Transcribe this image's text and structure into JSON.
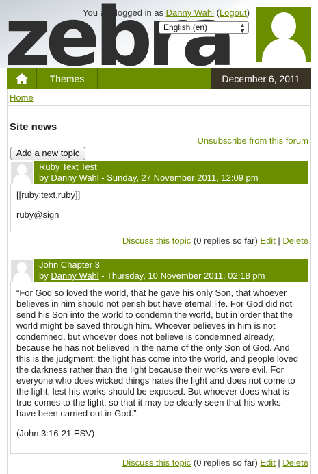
{
  "header": {
    "logo_text": "zebra",
    "login_prefix": "You are logged in as ",
    "user_name": "Danny Wahl",
    "logout_label": "Logout",
    "language": "English (en)"
  },
  "nav": {
    "themes_label": "Themes",
    "date": "December 6, 2011"
  },
  "breadcrumb": {
    "home_label": "Home"
  },
  "page": {
    "title": "Site news",
    "unsubscribe_label": "Unsubscribe from this forum",
    "add_topic_label": "Add a new topic"
  },
  "posts": [
    {
      "subject": "Ruby Text Test",
      "by": "by ",
      "author": "Danny Wahl",
      "date": " - Sunday, 27 November 2011, 12:09 pm",
      "paragraphs": [
        "[[ruby:text,ruby]]",
        "ruby@sign"
      ],
      "discuss_label": "Discuss this topic",
      "replies": " (0 replies so far) ",
      "edit_label": "Edit",
      "separator": " | ",
      "delete_label": "Delete"
    },
    {
      "subject": "John Chapter 3",
      "by": "by ",
      "author": "Danny Wahl",
      "date": " - Thursday, 10 November 2011, 02:18 pm",
      "paragraphs": [
        "“For God so loved the world, that he gave his only Son, that whoever believes in him should not perish but have eternal life. For God did not send his Son into the world to condemn the world, but in order that the world might be saved through him. Whoever believes in him is not condemned, but whoever does not believe is condemned already, because he has not believed in the name of the only Son of God. And this is the judgment: the light has come into the world, and people loved the darkness rather than the light because their works were evil. For everyone who does wicked things hates the light and does not come to the light, lest his works should be exposed. But whoever does what is true comes to the light, so that it may be clearly seen that his works have been carried out in God.”",
        "(John 3:16-21 ESV)"
      ],
      "discuss_label": "Discuss this topic",
      "replies": " (0 replies so far) ",
      "edit_label": "Edit",
      "separator": " | ",
      "delete_label": "Delete"
    }
  ],
  "colors": {
    "accent": "#6b8e00",
    "date_bg": "#3b3326"
  }
}
